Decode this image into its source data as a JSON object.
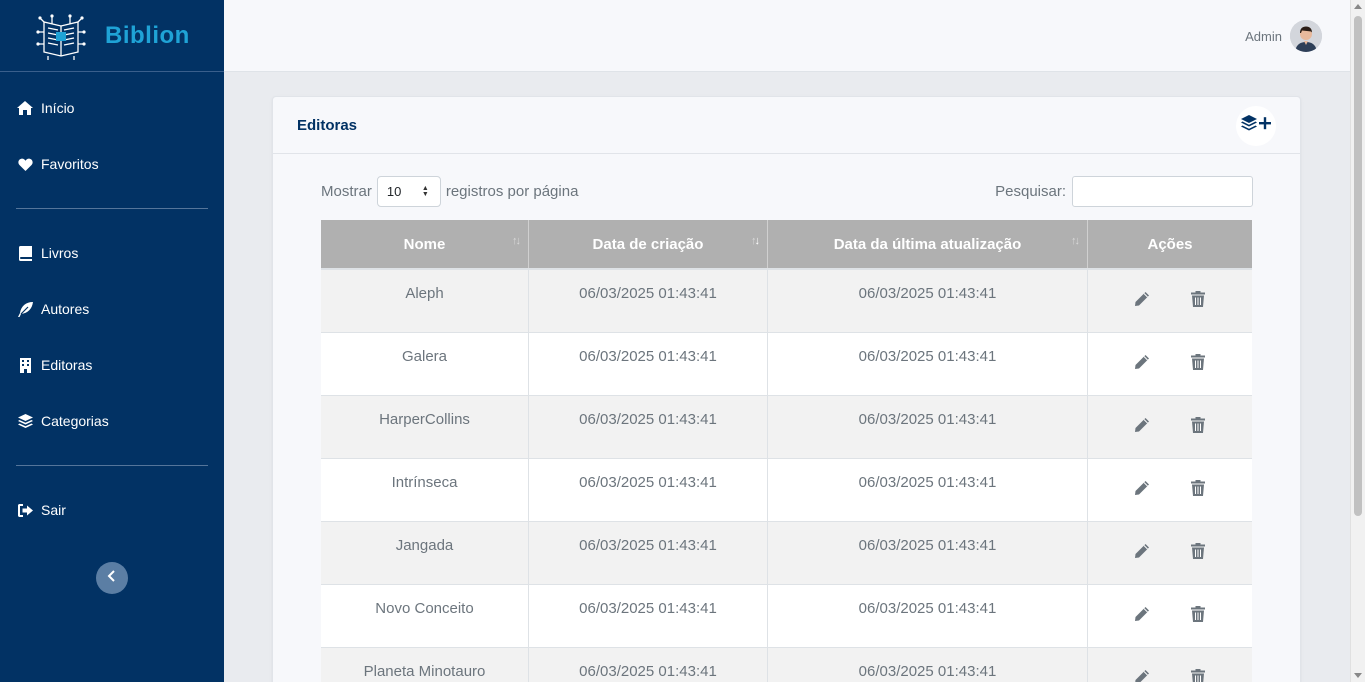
{
  "brand": {
    "name": "Biblion"
  },
  "sidebar": {
    "items": [
      {
        "label": "Início",
        "icon": "home-icon"
      },
      {
        "label": "Favoritos",
        "icon": "heart-icon"
      },
      {
        "label": "Livros",
        "icon": "book-icon"
      },
      {
        "label": "Autores",
        "icon": "feather-icon"
      },
      {
        "label": "Editoras",
        "icon": "building-icon"
      },
      {
        "label": "Categorias",
        "icon": "layers-icon"
      },
      {
        "label": "Sair",
        "icon": "sign-out-icon"
      }
    ],
    "collapse_icon": "chevron-left-icon"
  },
  "header": {
    "user_name": "Admin"
  },
  "card": {
    "title": "Editoras",
    "add_icon": "layers-plus-icon"
  },
  "controls": {
    "show_prefix": "Mostrar",
    "page_size": "10",
    "show_suffix": "registros por página",
    "search_label": "Pesquisar:",
    "search_value": ""
  },
  "table": {
    "columns": [
      "Nome",
      "Data de criação",
      "Data da última atualização",
      "Ações"
    ],
    "rows": [
      {
        "nome": "Aleph",
        "criacao": "06/03/2025 01:43:41",
        "atualizacao": "06/03/2025 01:43:41"
      },
      {
        "nome": "Galera",
        "criacao": "06/03/2025 01:43:41",
        "atualizacao": "06/03/2025 01:43:41"
      },
      {
        "nome": "HarperCollins",
        "criacao": "06/03/2025 01:43:41",
        "atualizacao": "06/03/2025 01:43:41"
      },
      {
        "nome": "Intrínseca",
        "criacao": "06/03/2025 01:43:41",
        "atualizacao": "06/03/2025 01:43:41"
      },
      {
        "nome": "Jangada",
        "criacao": "06/03/2025 01:43:41",
        "atualizacao": "06/03/2025 01:43:41"
      },
      {
        "nome": "Novo Conceito",
        "criacao": "06/03/2025 01:43:41",
        "atualizacao": "06/03/2025 01:43:41"
      },
      {
        "nome": "Planeta Minotauro",
        "criacao": "06/03/2025 01:43:41",
        "atualizacao": "06/03/2025 01:43:41"
      }
    ]
  },
  "colors": {
    "sidebar_bg": "#023264",
    "brand_accent": "#1fa3d6",
    "table_header_bg": "#b0b0b0",
    "icon_gray": "#6c757d"
  }
}
